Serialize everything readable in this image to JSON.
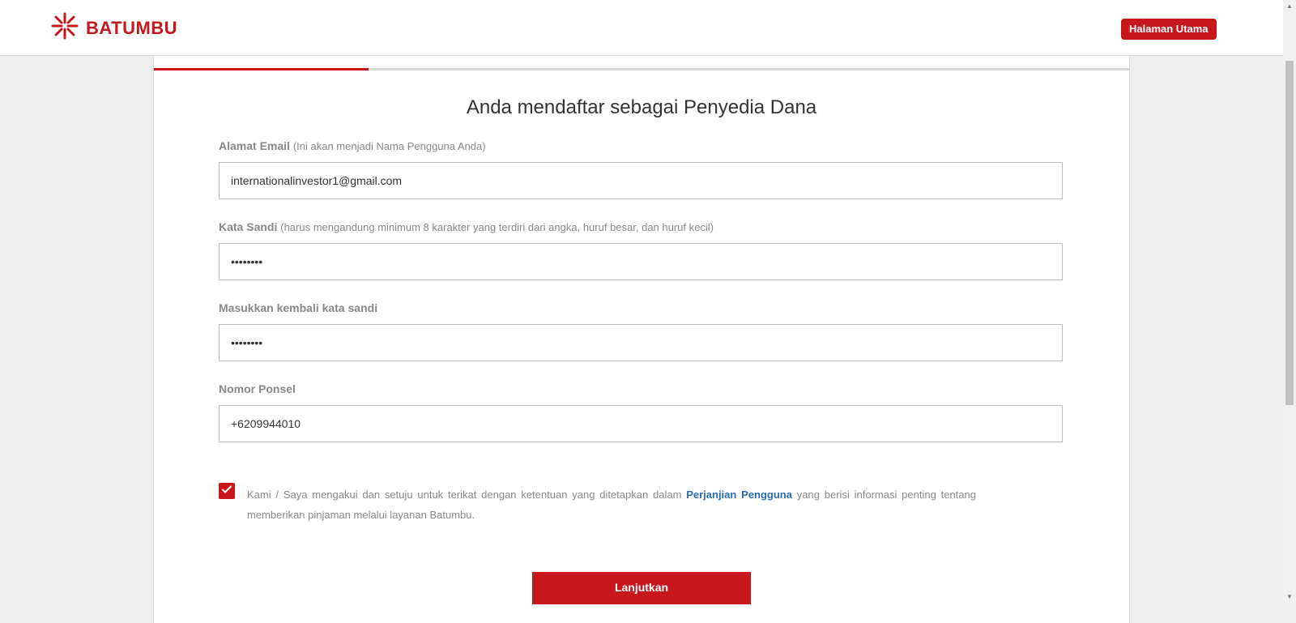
{
  "header": {
    "brand": "BATUMBU",
    "home_button": "Halaman Utama"
  },
  "progress": {
    "step_fraction": 0.22
  },
  "form": {
    "title": "Anda mendaftar sebagai Penyedia Dana",
    "email": {
      "label": "Alamat Email",
      "hint": "(Ini akan menjadi Nama Pengguna Anda)",
      "value": "internationalinvestor1@gmail.com"
    },
    "password": {
      "label": "Kata Sandi",
      "hint": "(harus mengandung minimum 8 karakter yang terdiri dari angka, huruf besar, dan huruf kecil)",
      "value": "••••••••"
    },
    "confirm_password": {
      "label": "Masukkan kembali kata sandi",
      "value": "••••••••"
    },
    "phone": {
      "label": "Nomor Ponsel",
      "value": "+6209944010"
    },
    "agreement": {
      "checked": true,
      "text_before": "Kami / Saya mengakui dan setuju untuk terikat dengan ketentuan yang ditetapkan dalam",
      "link": "Perjanjian Pengguna",
      "text_after": "yang berisi informasi penting tentang memberikan pinjaman melalui layanan Batumbu."
    },
    "submit_label": "Lanjutkan"
  },
  "colors": {
    "brand": "#c8161d",
    "link": "#2a6db0"
  },
  "icons": {
    "logo": "batumbu-logo-icon",
    "check": "checkmark-icon"
  }
}
